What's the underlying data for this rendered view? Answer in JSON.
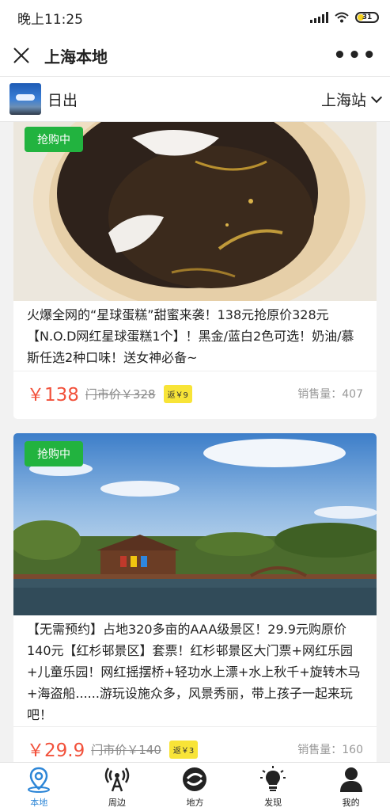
{
  "status_bar": {
    "time": "晚上11:25",
    "battery": "31"
  },
  "nav": {
    "title": "上海本地",
    "more": "•••"
  },
  "sub_header": {
    "name": "日出",
    "station": "上海站"
  },
  "cards": [
    {
      "badge": "抢购中",
      "description": "火爆全网的“星球蛋糕”甜蜜来袭！138元抢原价328元【N.O.D网红星球蛋糕1个】！黑金/蓝白2色可选！奶油/慕斯任选2种口味！送女神必备~",
      "currency": "￥",
      "price": "138",
      "original_price": "门市价￥328",
      "rebate": "返￥9",
      "sales": "销售量：407"
    },
    {
      "badge": "抢购中",
      "description": "【无需预约】占地320多亩的AAA级景区！29.9元购原价140元【红杉邨景区】套票！红杉邨景区大门票+网红乐园+儿童乐园！网红摇摆桥+轻功水上漂+水上秋千+旋转木马+海盗船......游玩设施众多，风景秀丽，带上孩子一起来玩吧！",
      "currency": "￥",
      "price": "29.9",
      "original_price": "门市价￥140",
      "rebate": "返￥3",
      "sales": "销售量：160"
    }
  ],
  "tabs": [
    {
      "label": "本地",
      "icon": "location-pin-icon",
      "active": true
    },
    {
      "label": "周边",
      "icon": "broadcast-tower-icon",
      "active": false
    },
    {
      "label": "地方",
      "icon": "swirl-logo-icon",
      "active": false
    },
    {
      "label": "发现",
      "icon": "lightbulb-icon",
      "active": false
    },
    {
      "label": "我的",
      "icon": "user-icon",
      "active": false
    }
  ],
  "colors": {
    "accent_blue": "#2d86d7",
    "price_red": "#f2513b",
    "badge_green": "#22b33f",
    "rebate_yellow": "#f8e437"
  }
}
